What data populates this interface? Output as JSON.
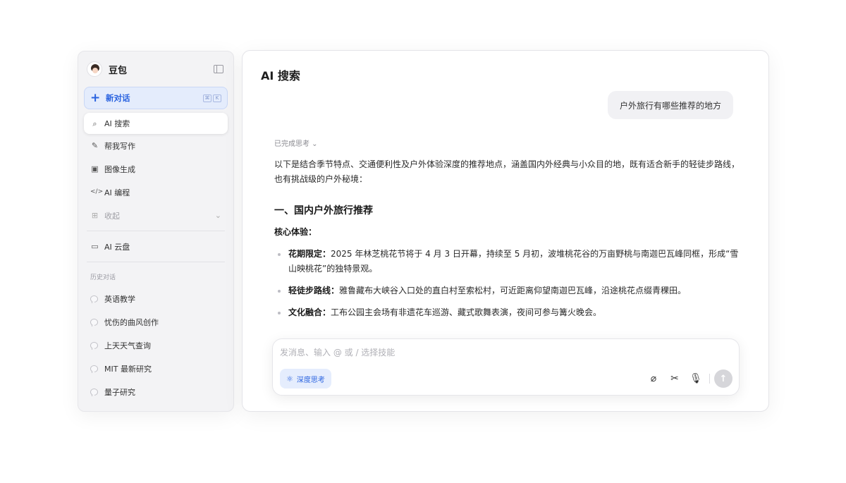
{
  "sidebar": {
    "app_name": "豆包",
    "new_chat": {
      "label": "新对话",
      "shortcut": [
        "⌘",
        "K"
      ]
    },
    "nav": [
      {
        "label": "AI 搜索",
        "icon": "search-spark-icon",
        "glyph": "⌕"
      },
      {
        "label": "帮我写作",
        "icon": "pen-icon",
        "glyph": "✎"
      },
      {
        "label": "图像生成",
        "icon": "image-icon",
        "glyph": "▣"
      },
      {
        "label": "AI 编程",
        "icon": "code-icon",
        "glyph": "</>"
      },
      {
        "label": "收起",
        "icon": "grid-icon",
        "glyph": "⊞"
      }
    ],
    "cloud": {
      "label": "AI 云盘",
      "icon": "folder-icon",
      "glyph": "▭"
    },
    "history_title": "历史对话",
    "history": [
      {
        "label": "英语教学"
      },
      {
        "label": "忧伤的曲风创作"
      },
      {
        "label": "上天天气查询"
      },
      {
        "label": "MIT 最新研究"
      },
      {
        "label": "量子研究"
      }
    ]
  },
  "main": {
    "title": "AI 搜索",
    "user_message": "户外旅行有哪些推荐的地方",
    "thinking_status": "已完成思考 ⌄",
    "intro": "以下是结合季节特点、交通便利性及户外体验深度的推荐地点，涵盖国内外经典与小众目的地，既有适合新手的轻徒步路线，也有挑战级的户外秘境：",
    "heading": "一、国内户外旅行推荐",
    "subheading": "核心体验：",
    "bullets": [
      {
        "label": "花期限定：",
        "text": "2025 年林芝桃花节将于 4 月 3 日开幕，持续至 5 月初，波堆桃花谷的万亩野桃与南迦巴瓦峰同框，形成“雪山映桃花”的独特景观。"
      },
      {
        "label": "轻徒步路线：",
        "text": "雅鲁藏布大峡谷入口处的直白村至索松村，可近距离仰望南迦巴瓦峰，沿途桃花点缀青稞田。"
      },
      {
        "label": "文化融合：",
        "text": "工布公园主会场有非遗花车巡游、藏式歌舞表演，夜间可参与篝火晚会。"
      }
    ]
  },
  "input": {
    "placeholder": "发消息、输入 @ 或 / 选择技能",
    "deep_think_label": "深度思考"
  },
  "colors": {
    "accent": "#2a63e0",
    "accent_bg": "#e4ecfc",
    "sidebar_bg": "#f3f3f5"
  }
}
